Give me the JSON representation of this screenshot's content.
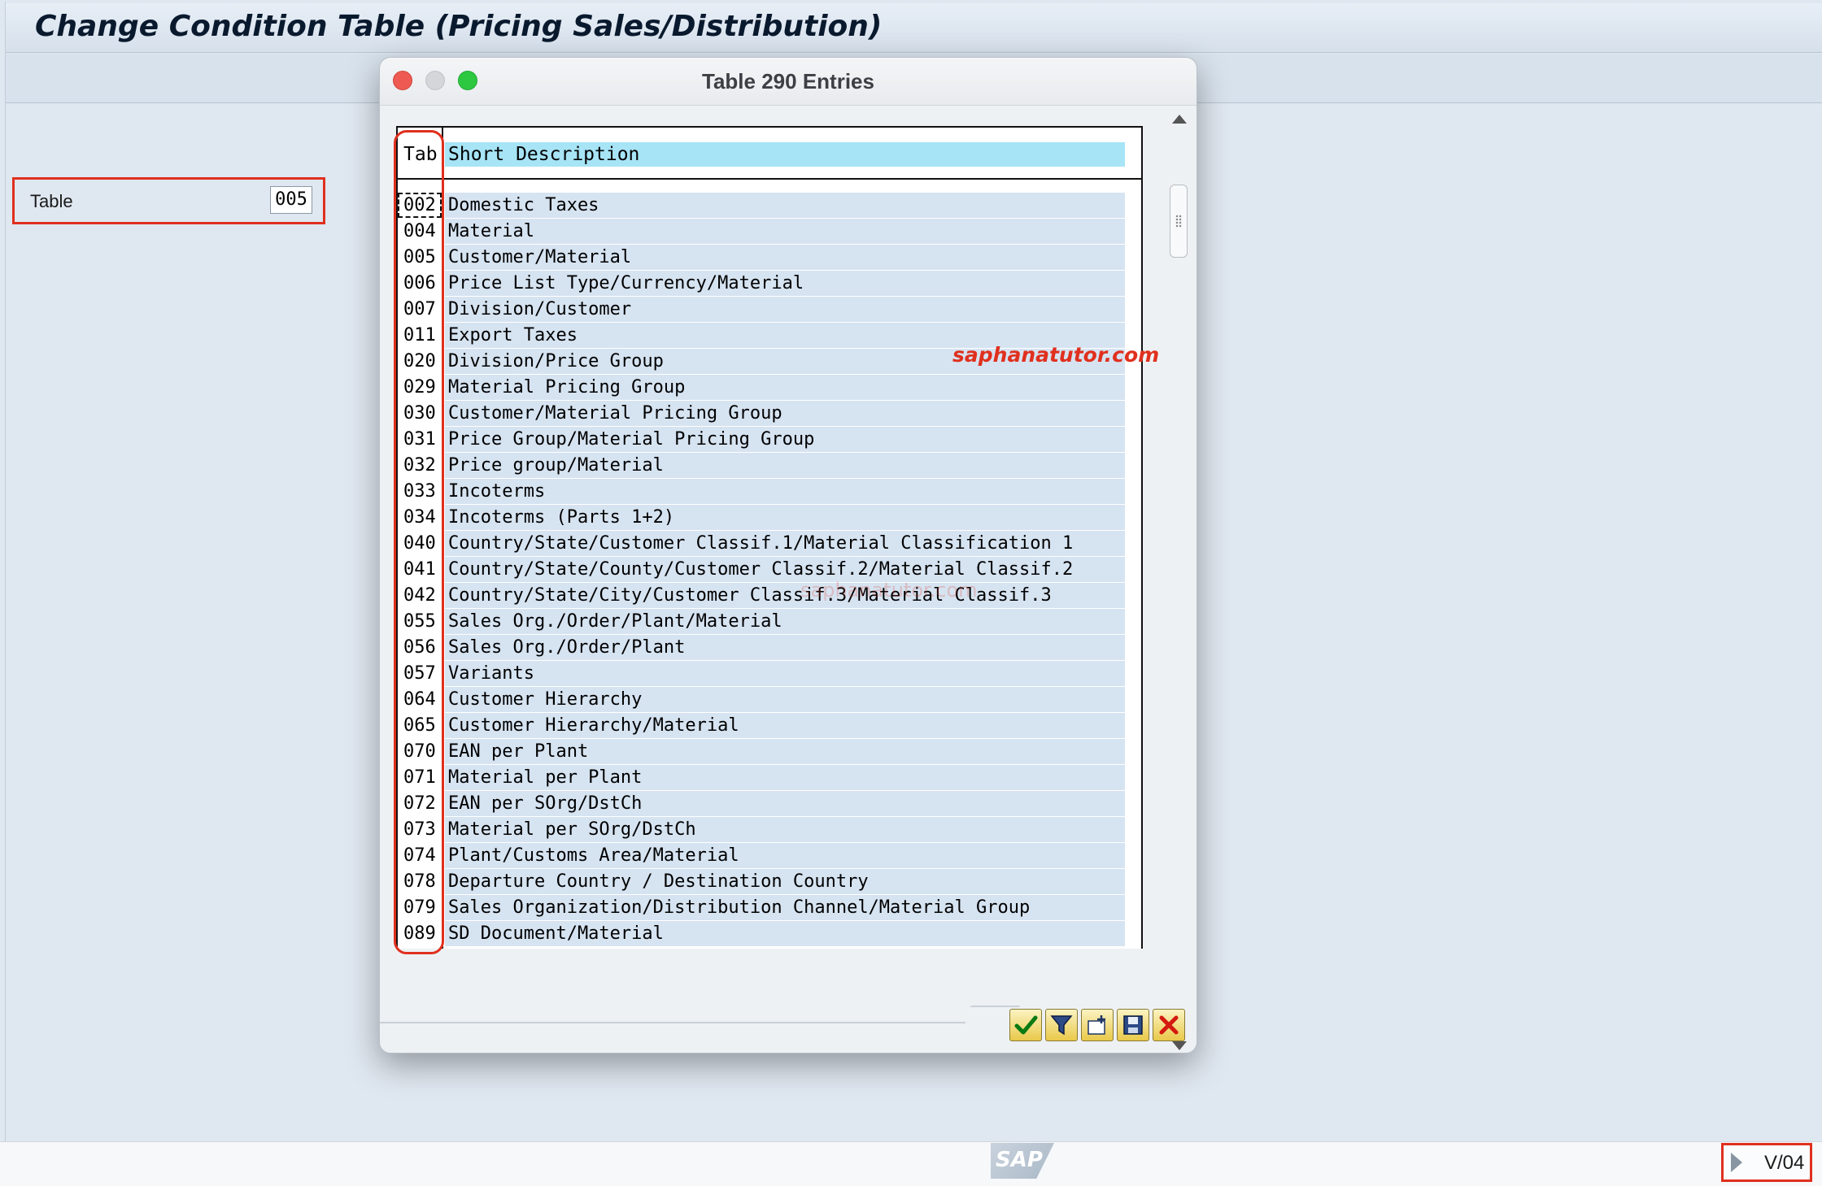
{
  "window": {
    "title": "Change Condition Table (Pricing Sales/Distribution)"
  },
  "field": {
    "label": "Table",
    "value": "005"
  },
  "dialog": {
    "title": "Table 290 Entries",
    "columns": {
      "tab": "Tab",
      "desc": "Short Description"
    },
    "rows": [
      {
        "tab": "002",
        "desc": "Domestic Taxes"
      },
      {
        "tab": "004",
        "desc": "Material"
      },
      {
        "tab": "005",
        "desc": "Customer/Material"
      },
      {
        "tab": "006",
        "desc": "Price List Type/Currency/Material"
      },
      {
        "tab": "007",
        "desc": "Division/Customer"
      },
      {
        "tab": "011",
        "desc": "Export Taxes"
      },
      {
        "tab": "020",
        "desc": "Division/Price Group"
      },
      {
        "tab": "029",
        "desc": "Material Pricing Group"
      },
      {
        "tab": "030",
        "desc": "Customer/Material Pricing Group"
      },
      {
        "tab": "031",
        "desc": "Price Group/Material Pricing Group"
      },
      {
        "tab": "032",
        "desc": "Price group/Material"
      },
      {
        "tab": "033",
        "desc": "Incoterms"
      },
      {
        "tab": "034",
        "desc": "Incoterms (Parts 1+2)"
      },
      {
        "tab": "040",
        "desc": "Country/State/Customer Classif.1/Material Classification 1"
      },
      {
        "tab": "041",
        "desc": "Country/State/County/Customer Classif.2/Material Classif.2"
      },
      {
        "tab": "042",
        "desc": "Country/State/City/Customer Classif.3/Material Classif.3"
      },
      {
        "tab": "055",
        "desc": "Sales Org./Order/Plant/Material"
      },
      {
        "tab": "056",
        "desc": "Sales Org./Order/Plant"
      },
      {
        "tab": "057",
        "desc": "Variants"
      },
      {
        "tab": "064",
        "desc": "Customer Hierarchy"
      },
      {
        "tab": "065",
        "desc": "Customer Hierarchy/Material"
      },
      {
        "tab": "070",
        "desc": "EAN per Plant"
      },
      {
        "tab": "071",
        "desc": "Material per Plant"
      },
      {
        "tab": "072",
        "desc": "EAN per SOrg/DstCh"
      },
      {
        "tab": "073",
        "desc": "Material per SOrg/DstCh"
      },
      {
        "tab": "074",
        "desc": "Plant/Customs Area/Material"
      },
      {
        "tab": "078",
        "desc": "Departure Country / Destination Country"
      },
      {
        "tab": "079",
        "desc": "Sales Organization/Distribution Channel/Material Group"
      },
      {
        "tab": "089",
        "desc": "SD Document/Material"
      }
    ],
    "buttons": [
      {
        "name": "continue-button",
        "icon": "check-icon"
      },
      {
        "name": "filter-button",
        "icon": "filter-icon"
      },
      {
        "name": "new-entry-button",
        "icon": "new-entry-icon"
      },
      {
        "name": "save-button",
        "icon": "save-icon"
      },
      {
        "name": "cancel-button",
        "icon": "cancel-icon"
      }
    ]
  },
  "watermark": "saphanatutor.com",
  "footer": {
    "logo": "SAP",
    "tcode": "V/04"
  },
  "colors": {
    "highlight": "#e0301e",
    "header_bg": "#a6e4f6",
    "row_bg": "#d6e3f1"
  }
}
